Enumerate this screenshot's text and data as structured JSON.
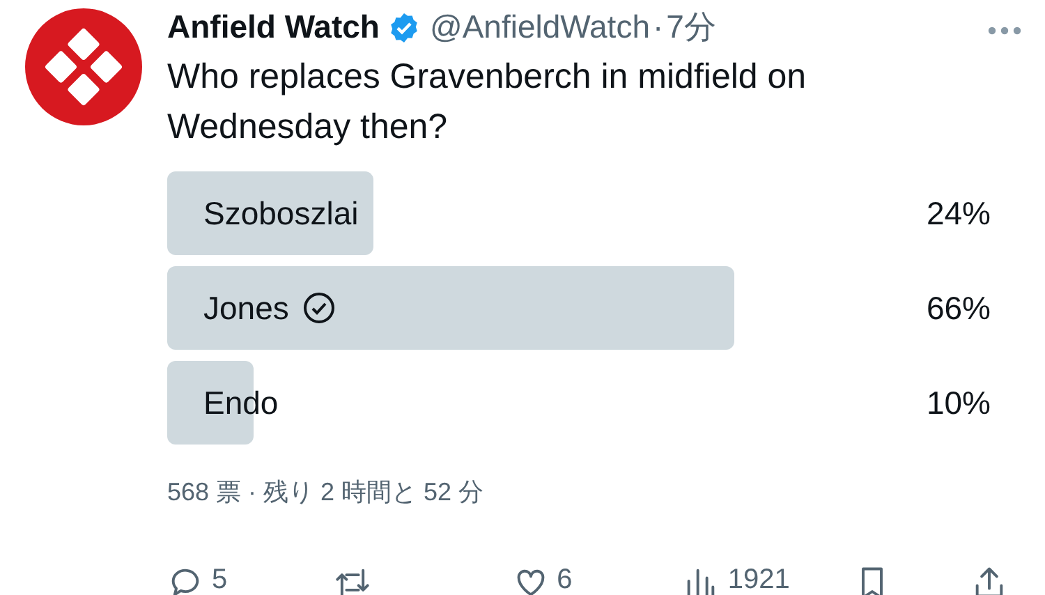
{
  "author": {
    "name": "Anfield Watch",
    "verified": true,
    "handle": "@AnfieldWatch",
    "separator": "·",
    "time": "7分"
  },
  "text": "Who replaces Gravenberch in midfield on Wednesday then?",
  "poll": {
    "options": [
      {
        "label": "Szoboszlai",
        "percent": "24%",
        "level": 0.24,
        "selected": false
      },
      {
        "label": "Jones",
        "percent": "66%",
        "level": 0.66,
        "selected": true
      },
      {
        "label": "Endo",
        "percent": "10%",
        "level": 0.1,
        "selected": false
      }
    ],
    "footer": "568 票 · 残り 2 時間と 52 分"
  },
  "actions": [
    {
      "kind": "reply",
      "count": "5"
    },
    {
      "kind": "retweet"
    },
    {
      "kind": "like",
      "count": "6"
    },
    {
      "kind": "views",
      "count": "1921"
    },
    {
      "kind": "bookmark"
    },
    {
      "kind": "share"
    }
  ]
}
